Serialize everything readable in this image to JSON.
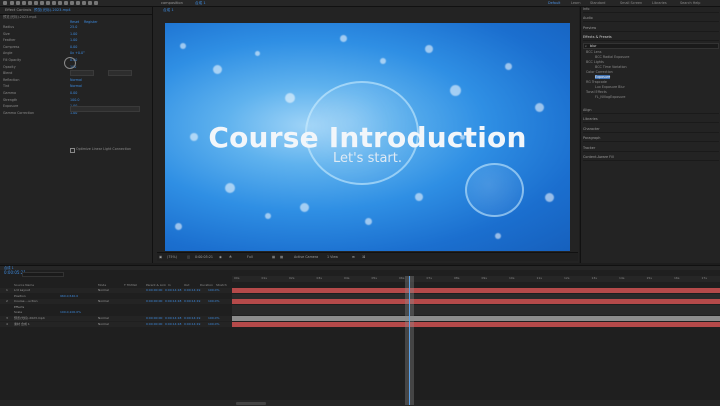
{
  "workspaces": [
    "Default",
    "Learn",
    "Standard",
    "Small Screen",
    "Libraries"
  ],
  "search_label": "Search Help",
  "left_panel": {
    "tab": "Effect Controls",
    "comp_name": "预览(光标).2023.mp4",
    "header_links": [
      "Reset",
      "Register"
    ],
    "props": [
      {
        "label": "Radius",
        "value": "25.0"
      },
      {
        "label": "Size",
        "value": "1.00"
      },
      {
        "label": "Feather",
        "value": "1.00"
      },
      {
        "label": "Compress",
        "value": "0.00"
      },
      {
        "label": "Angle",
        "value": "0x +0.0°"
      },
      {
        "label": "Fill Opacity",
        "value": "0.00"
      },
      {
        "label": "Opacity",
        "value": "100"
      },
      {
        "label": "Blend",
        "value": "Normal"
      },
      {
        "label": "Reflection",
        "value": "Normal"
      },
      {
        "label": "Tint",
        "value": "Normal"
      },
      {
        "label": "Gamma",
        "value": "0.00"
      },
      {
        "label": "Strength",
        "value": "100.0"
      },
      {
        "label": "Exposure",
        "value": "1.00"
      },
      {
        "label": "Gamma Correction",
        "value": "1.00"
      }
    ],
    "checkbox_label": "Optimize Linear Light Connection",
    "misc_label": "Ground"
  },
  "viewer": {
    "tab": "composition",
    "breadcrumb": "合成 1",
    "title": "Course Introduction",
    "subtitle": "Let's start.",
    "zoom": "(75%)",
    "timecode": "0:00:05:21",
    "quality": "Full",
    "camera": "Active Camera",
    "views": "1 View"
  },
  "right_panel": {
    "tabs": [
      "Info",
      "Audio",
      "Preview",
      "Effects & Presets"
    ],
    "search_value": "blur",
    "groups": [
      {
        "label": "BCC Lens",
        "item": "BCC Radial Exposure"
      },
      {
        "label": "BCC Lights",
        "item": "BCC Time Variation"
      },
      {
        "label": "Color Correction",
        "item": "Exposure"
      },
      {
        "label": "RG Trapcode",
        "item": "Lux Exposure Blur"
      },
      {
        "label": "Tonal Effects",
        "item": "FL_NVlogExposure"
      }
    ],
    "lower_tabs": [
      "Align",
      "Libraries",
      "Character",
      "Paragraph",
      "Tracker",
      "Content-Aware Fill"
    ]
  },
  "timeline": {
    "timecode": "0:00:05:21",
    "columns": [
      "Source Name",
      "Mode",
      "T TrkMat",
      "Parent & Link",
      "In",
      "Out",
      "Duration",
      "Stretch"
    ],
    "ticks": [
      "00s",
      "01s",
      "02s",
      "03s",
      "04s",
      "05s",
      "06s",
      "07s",
      "08s",
      "09s",
      "10s",
      "11s",
      "12s",
      "13s",
      "14s",
      "15s",
      "16s",
      "17s"
    ],
    "layers": [
      {
        "num": "1",
        "name": "Lrd Layout",
        "mode": "Normal",
        "in": "0:00:00:00",
        "out": "0:00:14:18",
        "dur": "0:00:14:19",
        "str": "100.0%"
      },
      {
        "num": "",
        "name": "Position",
        "mode": "",
        "in": "",
        "out": "",
        "dur": "",
        "str": "",
        "value": "960.0,540.0"
      },
      {
        "num": "2",
        "name": "Course ...uction",
        "mode": "Normal",
        "in": "0:00:00:00",
        "out": "0:00:14:18",
        "dur": "0:00:14:19",
        "str": "100.0%"
      },
      {
        "num": "",
        "name": "Effects",
        "mode": "",
        "in": "",
        "out": "",
        "dur": "",
        "str": ""
      },
      {
        "num": "",
        "name": "Scale",
        "mode": "",
        "in": "",
        "out": "",
        "dur": "",
        "str": "",
        "value": "100.0,100.0%"
      },
      {
        "num": "3",
        "name": "预览(光标).2023.mp4",
        "mode": "Normal",
        "in": "0:00:00:00",
        "out": "0:00:14:18",
        "dur": "0:00:14:19",
        "str": "100.0%"
      },
      {
        "num": "4",
        "name": "素材 合成 1",
        "mode": "Normal",
        "in": "0:00:00:00",
        "out": "0:00:14:18",
        "dur": "0:00:14:19",
        "str": "100.0%"
      }
    ]
  },
  "colors": {
    "accent": "#3d8be0",
    "track_red": "#b54a4a",
    "track_gray": "#8d8d8d"
  }
}
